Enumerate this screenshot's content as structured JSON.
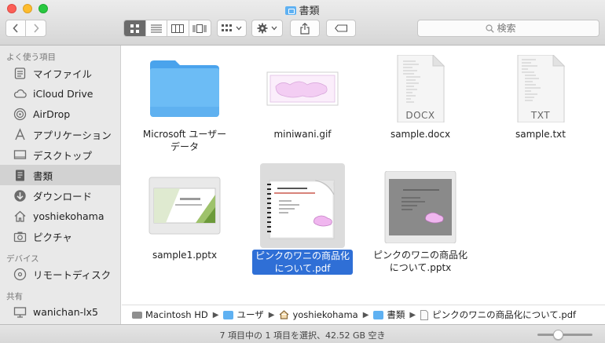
{
  "window": {
    "title": "書類"
  },
  "toolbar": {
    "back_icon": "chevron-left-icon",
    "forward_icon": "chevron-right-icon",
    "view_modes": [
      "icon-view",
      "list-view",
      "column-view",
      "coverflow-view"
    ],
    "active_view": "icon-view",
    "search_placeholder": "検索"
  },
  "sidebar": {
    "sections": [
      {
        "header": "よく使う項目",
        "items": [
          {
            "label": "マイファイル",
            "icon": "all-files-icon"
          },
          {
            "label": "iCloud Drive",
            "icon": "cloud-icon"
          },
          {
            "label": "AirDrop",
            "icon": "airdrop-icon"
          },
          {
            "label": "アプリケーション",
            "icon": "applications-icon"
          },
          {
            "label": "デスクトップ",
            "icon": "desktop-icon"
          },
          {
            "label": "書類",
            "icon": "documents-icon",
            "selected": true
          },
          {
            "label": "ダウンロード",
            "icon": "download-icon"
          },
          {
            "label": "yoshiekohama",
            "icon": "home-icon"
          },
          {
            "label": "ピクチャ",
            "icon": "camera-icon"
          }
        ]
      },
      {
        "header": "デバイス",
        "items": [
          {
            "label": "リモートディスク",
            "icon": "disc-icon"
          }
        ]
      },
      {
        "header": "共有",
        "items": [
          {
            "label": "wanichan-lx5",
            "icon": "display-icon"
          }
        ]
      }
    ]
  },
  "files": [
    {
      "name": "Microsoft ユーザー データ",
      "type": "folder"
    },
    {
      "name": "miniwani.gif",
      "type": "gif"
    },
    {
      "name": "sample.docx",
      "type": "docx",
      "ext_label": "DOCX"
    },
    {
      "name": "sample.txt",
      "type": "txt",
      "ext_label": "TXT"
    },
    {
      "name": "sample1.pptx",
      "type": "pptx"
    },
    {
      "name": "ピンクのワニの商品化について.pdf",
      "type": "pdf",
      "selected": true
    },
    {
      "name": "ピンクのワニの商品化について.pptx",
      "type": "pptx2"
    }
  ],
  "pathbar": [
    "Macintosh HD",
    "ユーザ",
    "yoshiekohama",
    "書類",
    "ピンクのワニの商品化について.pdf"
  ],
  "status": {
    "text": "7 項目中の 1 項目を選択、42.52 GB 空き",
    "zoom_level": 0.35
  },
  "colors": {
    "selection": "#2f6fd6",
    "folder": "#5fb1f2"
  }
}
